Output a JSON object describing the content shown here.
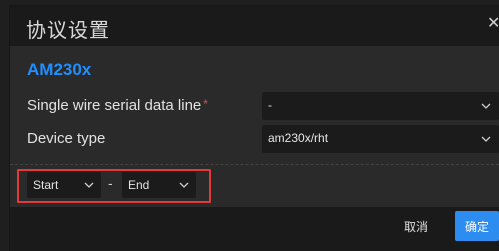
{
  "dialog": {
    "title": "协议设置",
    "close_icon": "close-icon"
  },
  "section": {
    "title": "AM230x"
  },
  "fields": {
    "data_line": {
      "label": "Single wire serial data line",
      "required_mark": "*",
      "value": "-",
      "icon": "chevron-down-icon"
    },
    "device_type": {
      "label": "Device type",
      "value": "am230x/rht",
      "icon": "chevron-down-icon"
    }
  },
  "range": {
    "start_value": "Start",
    "separator": "-",
    "end_value": "End",
    "highlight_color": "#e03a3a"
  },
  "footer": {
    "cancel_label": "取消",
    "ok_label": "确定"
  },
  "colors": {
    "accent": "#2d8cf0",
    "section_title": "#1f8fff",
    "required": "#e84a4a"
  }
}
